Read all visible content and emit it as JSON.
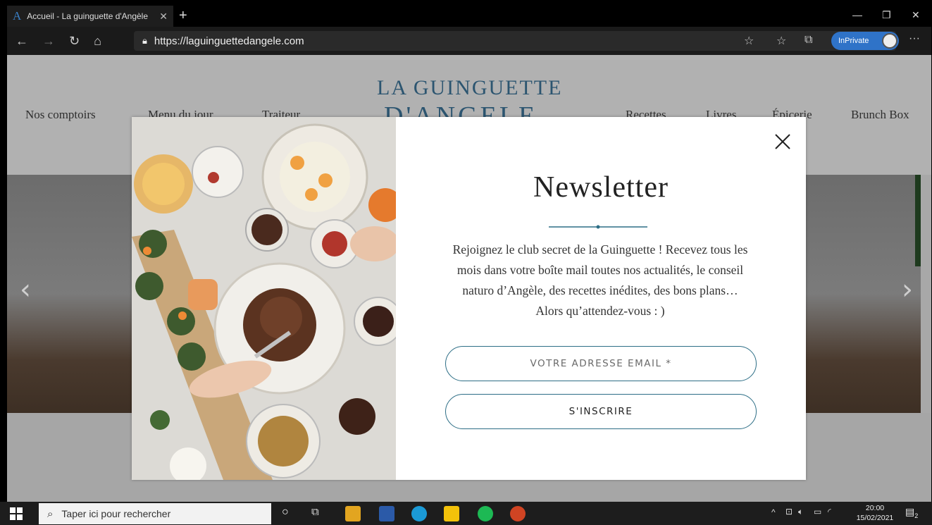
{
  "browser": {
    "tab_title": "Accueil - La guinguette d'Angèle",
    "tab_favicon": "A",
    "url": "https://laguinguettedangele.com",
    "inprivate_label": "InPrivate",
    "icons": [
      "back-icon",
      "forward-icon",
      "refresh-icon",
      "home-icon",
      "lock-icon",
      "add-favorite-icon",
      "favorites-icon",
      "collections-icon",
      "more-icon",
      "minimize-icon",
      "maximize-icon",
      "close-icon"
    ]
  },
  "site": {
    "logo_line1": "LA GUINGUETTE",
    "logo_line2": "D'ANGELE",
    "nav_left": [
      "Nos comptoirs",
      "Menu du jour",
      "Traiteur"
    ],
    "nav_right": [
      "Recettes",
      "Livres",
      "Épicerie",
      "Brunch Box"
    ]
  },
  "modal": {
    "title": "Newsletter",
    "text_line1": "Rejoignez le club secret de la Guinguette ! Recevez tous les",
    "text_line2": "mois dans votre boîte mail toutes nos actualités, le conseil",
    "text_line3": "naturo d’Angèle, des recettes inédites, des bons plans…",
    "text_line4": "Alors qu’attendez-vous : )",
    "email_placeholder": "VOTRE ADRESSE EMAIL *",
    "subscribe_label": "S'INSCRIRE",
    "accent_color": "#2d6e86"
  },
  "taskbar": {
    "search_placeholder": "Taper ici pour rechercher",
    "time": "20:00",
    "date": "15/02/2021",
    "notification_count": "2"
  }
}
